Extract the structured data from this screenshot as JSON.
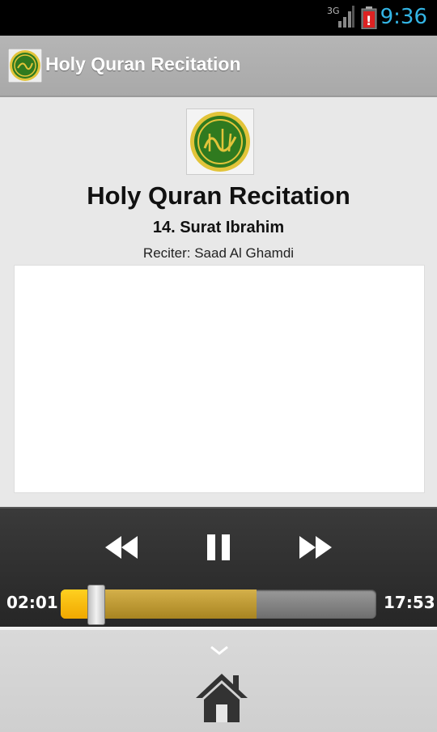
{
  "status_bar": {
    "network": "3G",
    "time": "9:36"
  },
  "action_bar": {
    "title": "Holy Quran Recitation"
  },
  "main": {
    "title": "Holy Quran Recitation",
    "surah": "14. Surat Ibrahim",
    "reciter": "Reciter: Saad Al Ghamdi"
  },
  "player": {
    "elapsed": "02:01",
    "duration": "17:53",
    "played_fraction": 0.113,
    "buffered_fraction": 0.62
  },
  "colors": {
    "accent_blue": "#33b5e5",
    "progress_played": "#f7b800",
    "progress_buffered": "#c09a36",
    "logo_green": "#2f7a1f",
    "logo_gold": "#e2c43a"
  }
}
